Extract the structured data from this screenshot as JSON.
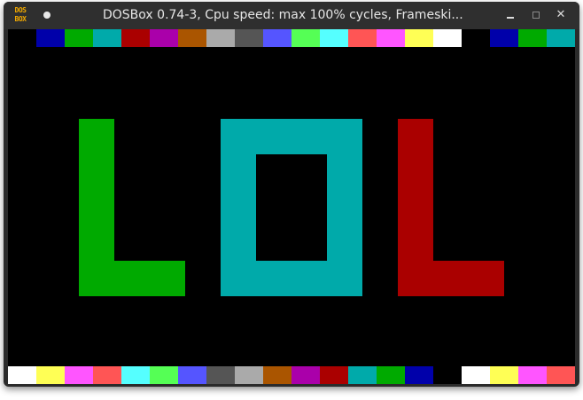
{
  "window": {
    "title": "DOSBox 0.74-3, Cpu speed: max 100% cycles, Frameski...",
    "icon_text_top": "DOS",
    "icon_text_bottom": "BOX",
    "icons": [
      "dosbox-app-icon",
      "pin-dot-icon",
      "minimize-icon",
      "maximize-icon",
      "close-icon"
    ],
    "close_glyph": "✕"
  },
  "screen": {
    "background": "#000000",
    "top_palette": [
      "#000000",
      "#0000aa",
      "#00aa00",
      "#00aaaa",
      "#aa0000",
      "#aa00aa",
      "#aa5500",
      "#aaaaaa",
      "#555555",
      "#5555ff",
      "#55ff55",
      "#55ffff",
      "#ff5555",
      "#ff55ff",
      "#ffff55",
      "#ffffff",
      "#000000",
      "#0000aa",
      "#00aa00",
      "#00aaaa"
    ],
    "bottom_palette": [
      "#ffffff",
      "#ffff55",
      "#ff55ff",
      "#ff5555",
      "#55ffff",
      "#55ff55",
      "#5555ff",
      "#555555",
      "#aaaaaa",
      "#aa5500",
      "#aa00aa",
      "#aa0000",
      "#00aaaa",
      "#00aa00",
      "#0000aa",
      "#000000",
      "#ffffff",
      "#ffff55",
      "#ff55ff",
      "#ff5555"
    ],
    "letters": [
      {
        "name": "letter-l-left",
        "color": "#00aa00"
      },
      {
        "name": "letter-o-middle",
        "color": "#00aaaa"
      },
      {
        "name": "letter-l-right",
        "color": "#aa0000"
      }
    ]
  }
}
